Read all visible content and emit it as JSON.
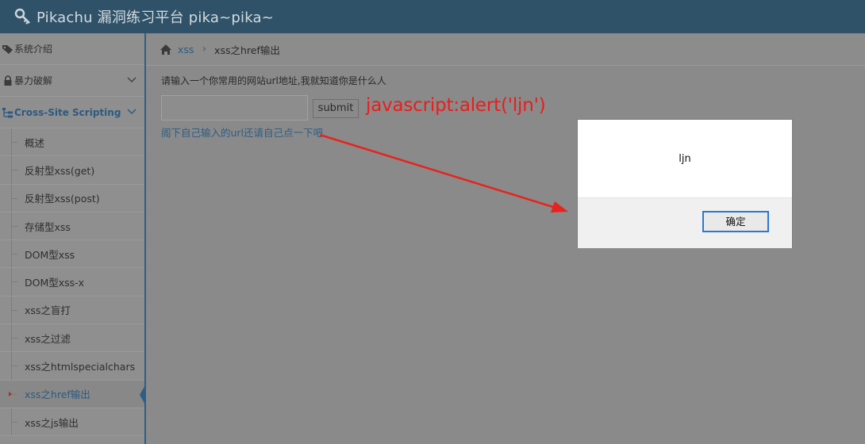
{
  "header": {
    "title": "Pikachu 漏洞练习平台 pika~pika~",
    "icon": "wrench-key-icon"
  },
  "sidebar": {
    "items": [
      {
        "label": "系统介绍",
        "icon": "tag-icon"
      },
      {
        "label": "暴力破解",
        "icon": "lock-icon"
      },
      {
        "label": "Cross-Site Scripting",
        "icon": "sitemap-icon"
      }
    ],
    "sub_items": [
      "概述",
      "反射型xss(get)",
      "反射型xss(post)",
      "存储型xss",
      "DOM型xss",
      "DOM型xss-x",
      "xss之盲打",
      "xss之过滤",
      "xss之htmlspecialchars",
      "xss之href输出",
      "xss之js输出"
    ],
    "active_sub_index": 9
  },
  "breadcrumb": {
    "link": "xss",
    "current": "xss之href输出"
  },
  "main": {
    "prompt": "请输入一个你常用的网站url地址,我就知道你是什么人",
    "input_value": "",
    "submit_label": "submit",
    "result_link": "阁下自己输入的url还请自己点一下吧",
    "annotation": "javascript:alert('ljn')"
  },
  "dialog": {
    "message": "ljn",
    "ok_label": "确定"
  },
  "colors": {
    "annotation": "#ee1b1b",
    "accent": "#2c5a80",
    "focus_border": "#2b78d4"
  }
}
